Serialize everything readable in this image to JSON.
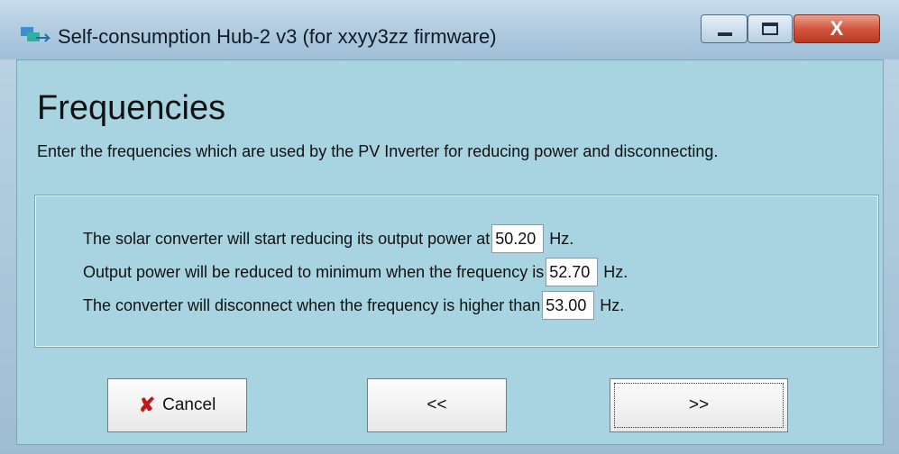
{
  "window": {
    "title": "Self-consumption Hub-2 v3 (for xxyy3zz firmware)",
    "controls": {
      "minimize_icon": "minimize-icon",
      "maximize_icon": "maximize-icon",
      "close_label": "X"
    }
  },
  "page": {
    "heading": "Frequencies",
    "description": "Enter the frequencies which are used by the PV Inverter for reducing power and disconnecting."
  },
  "settings": {
    "rows": [
      {
        "label": "The solar converter will start reducing its output power at",
        "value": "50.20",
        "unit": "Hz."
      },
      {
        "label": "Output power will be reduced to minimum when the frequency is",
        "value": "52.70",
        "unit": "Hz."
      },
      {
        "label": "The converter will disconnect when the frequency is higher than",
        "value": "53.00",
        "unit": "Hz."
      }
    ]
  },
  "buttons": {
    "cancel_label": "Cancel",
    "back_label": "<<",
    "next_label": ">>"
  },
  "icons": {
    "app": "app-icon",
    "cancel": "x-icon"
  },
  "colors": {
    "cancel_icon": "#c01818",
    "close_button": "#d2553e"
  }
}
